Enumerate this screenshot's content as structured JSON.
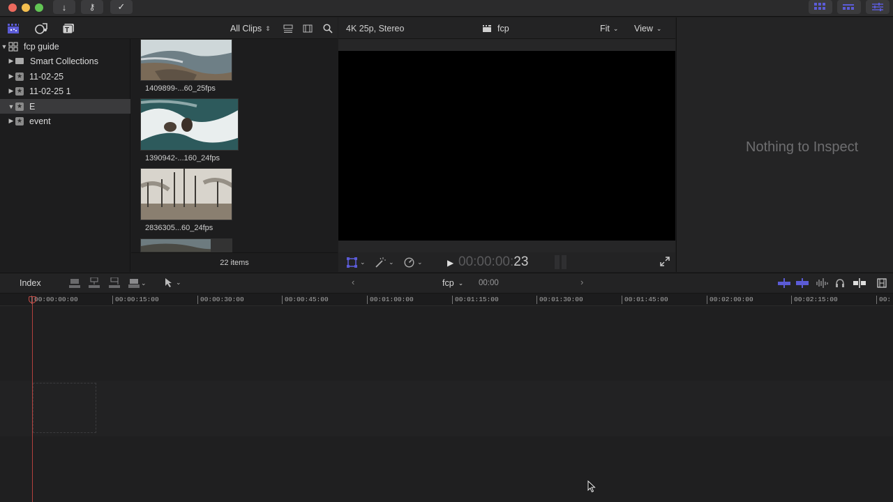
{
  "browser": {
    "filter_label": "All Clips",
    "sidebar": [
      {
        "label": "fcp guide",
        "expanded": true,
        "type": "library"
      },
      {
        "label": "Smart Collections",
        "expanded": false,
        "type": "folder"
      },
      {
        "label": "11-02-25",
        "expanded": false,
        "type": "event"
      },
      {
        "label": "11-02-25 1",
        "expanded": false,
        "type": "event"
      },
      {
        "label": "E",
        "expanded": true,
        "type": "event",
        "selected": true
      },
      {
        "label": "event",
        "expanded": false,
        "type": "event"
      }
    ],
    "clips": [
      {
        "name": "1409899-...60_25fps"
      },
      {
        "name": "1390942-...160_24fps"
      },
      {
        "name": "2836305...60_24fps"
      }
    ],
    "item_count": "22 items"
  },
  "viewer": {
    "format": "4K 25p, Stereo",
    "project_name": "fcp",
    "fit_label": "Fit",
    "view_label": "View",
    "timecode_dim": "00:00:00:",
    "timecode_frame": "23"
  },
  "inspector": {
    "empty_text": "Nothing to Inspect"
  },
  "timeline": {
    "index_label": "Index",
    "project_name": "fcp",
    "duration": "00:00",
    "ruler": [
      "00:00:00:00",
      "00:00:15:00",
      "00:00:30:00",
      "00:00:45:00",
      "00:01:00:00",
      "00:01:15:00",
      "00:01:30:00",
      "00:01:45:00",
      "00:02:00:00",
      "00:02:15:00",
      "00:"
    ]
  },
  "colors": {
    "accent": "#5b5bd6",
    "playhead": "#b3413d"
  },
  "icons": {
    "import": "arrow-down-icon",
    "keywords": "key-icon",
    "background_tasks": "checkmark-circle-icon"
  }
}
